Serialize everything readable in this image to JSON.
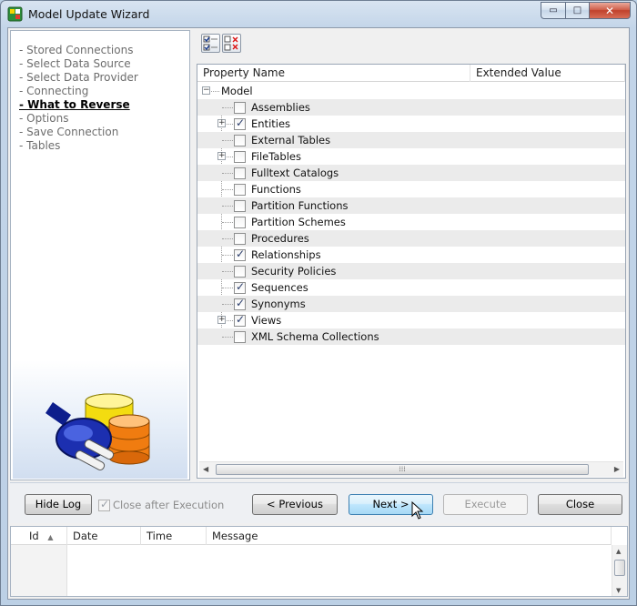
{
  "window": {
    "title": "Model Update Wizard",
    "controls": {
      "minimize": "▭",
      "maximize": "□",
      "close": "✕"
    }
  },
  "nav": {
    "items": [
      {
        "label": "- Stored Connections",
        "active": false
      },
      {
        "label": "- Select Data Source",
        "active": false
      },
      {
        "label": "- Select Data Provider",
        "active": false
      },
      {
        "label": "- Connecting",
        "active": false
      },
      {
        "label": "- What to Reverse",
        "active": true
      },
      {
        "label": "- Options",
        "active": false
      },
      {
        "label": "- Save Connection",
        "active": false
      },
      {
        "label": "- Tables",
        "active": false
      }
    ]
  },
  "toolbar": {
    "check_all_icon": "check-all-icon",
    "uncheck_all_icon": "uncheck-all-icon"
  },
  "grid": {
    "columns": [
      "Property Name",
      "Extended Value"
    ],
    "root_label": "Model",
    "rows": [
      {
        "label": "Assemblies",
        "checked": false,
        "expandable": false
      },
      {
        "label": "Entities",
        "checked": true,
        "expandable": true
      },
      {
        "label": "External Tables",
        "checked": false,
        "expandable": false
      },
      {
        "label": "FileTables",
        "checked": false,
        "expandable": true
      },
      {
        "label": "Fulltext Catalogs",
        "checked": false,
        "expandable": false
      },
      {
        "label": "Functions",
        "checked": false,
        "expandable": false
      },
      {
        "label": "Partition Functions",
        "checked": false,
        "expandable": false
      },
      {
        "label": "Partition Schemes",
        "checked": false,
        "expandable": false
      },
      {
        "label": "Procedures",
        "checked": false,
        "expandable": false
      },
      {
        "label": "Relationships",
        "checked": true,
        "expandable": false
      },
      {
        "label": "Security Policies",
        "checked": false,
        "expandable": false
      },
      {
        "label": "Sequences",
        "checked": true,
        "expandable": false
      },
      {
        "label": "Synonyms",
        "checked": true,
        "expandable": false
      },
      {
        "label": "Views",
        "checked": true,
        "expandable": true
      },
      {
        "label": "XML Schema Collections",
        "checked": false,
        "expandable": false
      }
    ]
  },
  "buttons": {
    "hide_log": "Hide Log",
    "close_after_execution": "Close after Execution",
    "close_after_execution_checked": true,
    "previous": "< Previous",
    "next": "Next >",
    "execute": "Execute",
    "close": "Close"
  },
  "log": {
    "columns": [
      "Id",
      "Date",
      "Time",
      "Message"
    ]
  }
}
